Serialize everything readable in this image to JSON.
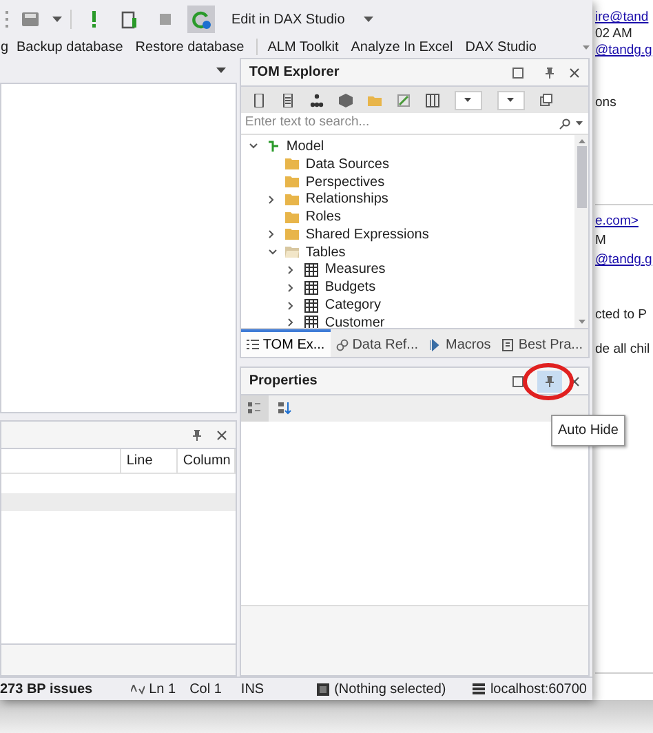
{
  "toolbar": {
    "buttons": [
      {
        "kind": "save",
        "hovered": false
      },
      {
        "kind": "run",
        "hovered": false
      },
      {
        "kind": "deploy",
        "hovered": false
      },
      {
        "kind": "stop",
        "hovered": false
      },
      {
        "kind": "refresh",
        "hovered": true
      }
    ],
    "edit_button": "Edit in DAX Studio"
  },
  "menu": [
    "g",
    "Backup database",
    "Restore database",
    "ALM Toolkit",
    "Analyze In Excel",
    "DAX Studio"
  ],
  "tom_explorer": {
    "title": "TOM Explorer",
    "search": {
      "placeholder": "Enter text to search..."
    },
    "tree": [
      {
        "label": "Model",
        "kind": "model",
        "expandable": true,
        "expanded": true,
        "children": [
          {
            "label": "Data Sources",
            "kind": "folder",
            "expandable": false
          },
          {
            "label": "Perspectives",
            "kind": "folder",
            "expandable": false
          },
          {
            "label": "Relationships",
            "kind": "folder",
            "expandable": true,
            "expanded": false
          },
          {
            "label": "Roles",
            "kind": "folder",
            "expandable": false
          },
          {
            "label": "Shared Expressions",
            "kind": "folder",
            "expandable": true,
            "expanded": false
          },
          {
            "label": "Tables",
            "kind": "open-folder",
            "expandable": true,
            "expanded": true,
            "children": [
              {
                "label": "Measures",
                "kind": "table",
                "expandable": true,
                "expanded": false
              },
              {
                "label": "Budgets",
                "kind": "table",
                "expandable": true,
                "expanded": false
              },
              {
                "label": "Category",
                "kind": "table",
                "expandable": true,
                "expanded": false
              },
              {
                "label": "Customer",
                "kind": "table",
                "expandable": true,
                "expanded": false
              }
            ]
          }
        ]
      }
    ],
    "tabs": [
      {
        "label": "TOM Ex...",
        "selected": true
      },
      {
        "label": "Data Ref...",
        "selected": false
      },
      {
        "label": "Macros",
        "selected": false
      },
      {
        "label": "Best Pra...",
        "selected": false
      }
    ]
  },
  "properties": {
    "title": "Properties",
    "pin_hovered": true,
    "tooltip": "Auto Hide"
  },
  "output_panel": {
    "columns": [
      "Line",
      "Column"
    ]
  },
  "status_bar": {
    "issues": "273 BP issues",
    "line": "Ln 1",
    "column": "Col 1",
    "mode": "INS",
    "selection": "(Nothing selected)",
    "server": "localhost:60700"
  },
  "email_behind": [
    {
      "text": "ire@tand",
      "link": true
    },
    {
      "text": "02 AM",
      "link": false
    },
    {
      "text": "@tandg.g",
      "link": true
    },
    {
      "text": "ons",
      "link": false
    },
    {
      "text": "e.com>",
      "link": true
    },
    {
      "text": "M",
      "link": false
    },
    {
      "text": "@tandg.g",
      "link": true
    },
    {
      "text": "cted to P",
      "link": false
    },
    {
      "text": "de all chil",
      "link": false
    }
  ]
}
